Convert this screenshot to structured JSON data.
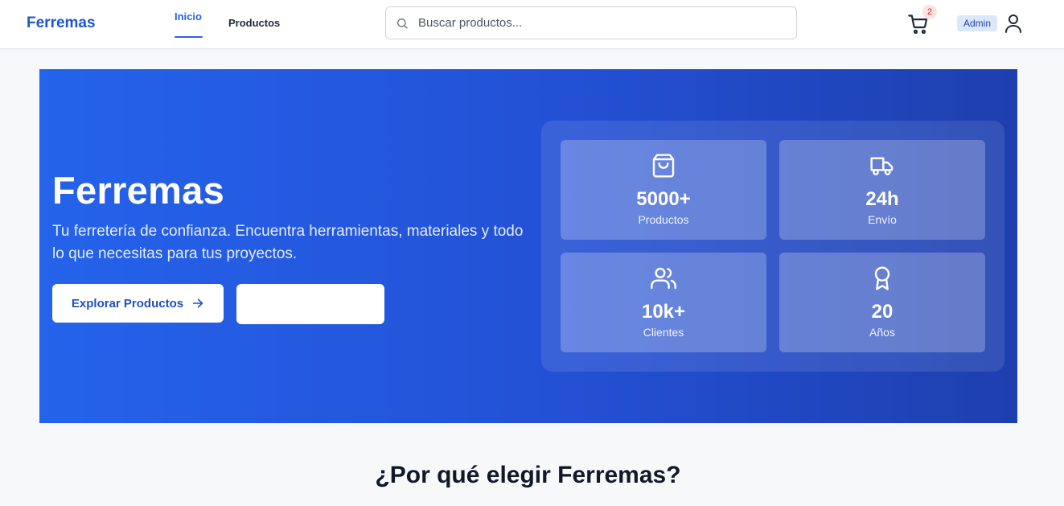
{
  "header": {
    "brand": "Ferremas",
    "nav": {
      "inicio": "Inicio",
      "productos": "Productos"
    },
    "search": {
      "placeholder": "Buscar productos..."
    },
    "cart": {
      "count": "2",
      "icon": "cart-icon"
    },
    "admin_label": "Admin",
    "user_icon": "user-icon"
  },
  "hero": {
    "title": "Ferremas",
    "subtitle": "Tu ferretería de confianza. Encuentra herramientas, materiales y todo lo que necesitas para tus proyectos.",
    "explore_button": "Explorar Productos",
    "second_button": "",
    "stats": [
      {
        "icon": "shopping-bag-icon",
        "value": "5000+",
        "label": "Productos"
      },
      {
        "icon": "truck-icon",
        "value": "24h",
        "label": "Envío"
      },
      {
        "icon": "users-icon",
        "value": "10k+",
        "label": "Clientes"
      },
      {
        "icon": "award-icon",
        "value": "20",
        "label": "Años"
      }
    ]
  },
  "features": {
    "title": "¿Por qué elegir Ferremas?"
  },
  "colors": {
    "brand": "#1f56c7",
    "accent": "#2563eb",
    "hero_start": "#2463eb",
    "hero_end": "#1e3fae",
    "badge_bg": "#fde2e2",
    "badge_text": "#dc2626"
  }
}
